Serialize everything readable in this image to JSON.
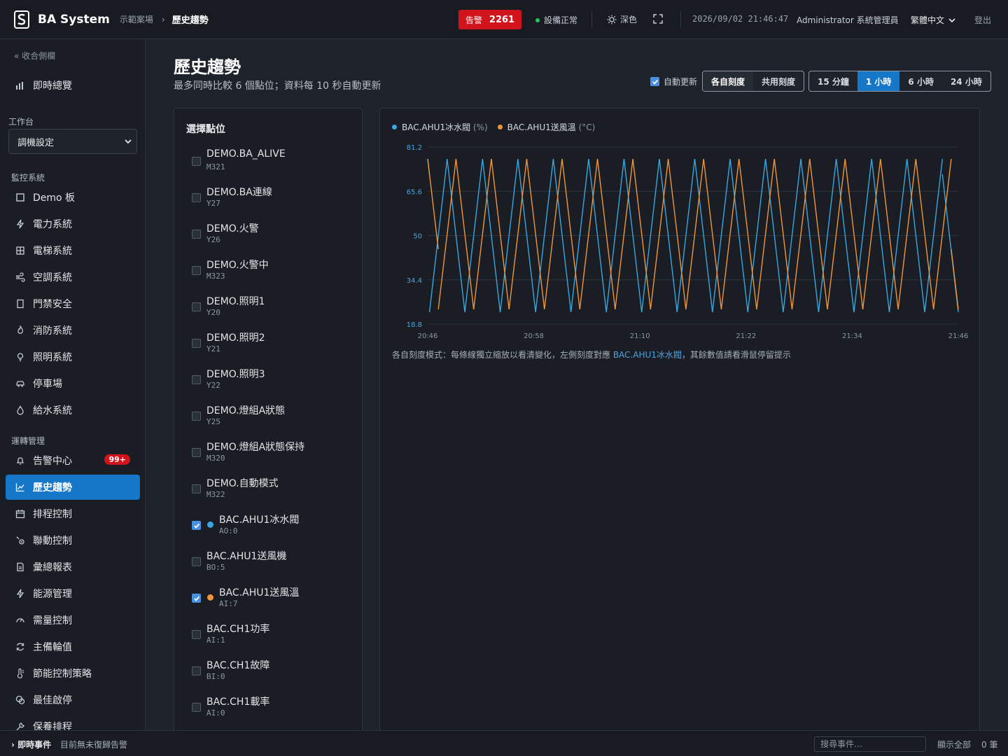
{
  "header": {
    "brand": "BA System",
    "site": "示範案場",
    "separator": "›",
    "current_page": "歷史趨勢",
    "alarm_label": "告警",
    "alarm_count": "2261",
    "device_status": "設備正常",
    "theme_label": "深色",
    "datetime": "2026/09/02 21:46:47",
    "user": "Administrator 系統管理員",
    "language": "繁體中文",
    "logout": "登出",
    "status_color": "#22c55e",
    "alarm_color": "#d1141c"
  },
  "sidebar": {
    "collapse_label": "« 收合側欄",
    "overview": "即時總覽",
    "workbench_label": "工作台",
    "workbench_value": "調機設定",
    "monitor_label": "監控系統",
    "monitor_items": [
      {
        "label": "Demo 板",
        "icon": "square-icon"
      },
      {
        "label": "電力系統",
        "icon": "bolt-icon"
      },
      {
        "label": "電梯系統",
        "icon": "elevator-icon"
      },
      {
        "label": "空調系統",
        "icon": "wind-icon"
      },
      {
        "label": "門禁安全",
        "icon": "door-icon"
      },
      {
        "label": "消防系統",
        "icon": "flame-icon"
      },
      {
        "label": "照明系統",
        "icon": "bulb-icon"
      },
      {
        "label": "停車場",
        "icon": "car-icon"
      },
      {
        "label": "給水系統",
        "icon": "drop-icon"
      }
    ],
    "ops_label": "運轉管理",
    "ops_items": [
      {
        "label": "告警中心",
        "icon": "bell-icon",
        "badge": "99+"
      },
      {
        "label": "歷史趨勢",
        "icon": "trend-icon",
        "active": true
      },
      {
        "label": "排程控制",
        "icon": "calendar-icon"
      },
      {
        "label": "聯動控制",
        "icon": "link-icon"
      },
      {
        "label": "彙總報表",
        "icon": "report-icon"
      },
      {
        "label": "能源管理",
        "icon": "bolt-icon"
      },
      {
        "label": "需量控制",
        "icon": "gauge-icon"
      },
      {
        "label": "主備輪值",
        "icon": "rotate-icon"
      },
      {
        "label": "節能控制策略",
        "icon": "thermometer-icon"
      },
      {
        "label": "最佳啟停",
        "icon": "optimize-icon"
      },
      {
        "label": "保養排程",
        "icon": "wrench-icon"
      }
    ]
  },
  "page": {
    "title": "歷史趨勢",
    "subtitle": "最多同時比較 6 個點位；資料每 10 秒自動更新",
    "auto_refresh": "自動更新",
    "scale_modes": [
      "各自刻度",
      "共用刻度"
    ],
    "ranges": [
      "15 分鐘",
      "1 小時",
      "6 小時",
      "24 小時"
    ]
  },
  "points": {
    "title": "選擇點位",
    "items": [
      {
        "name": "DEMO.BA_ALIVE",
        "code": "M321",
        "checked": false
      },
      {
        "name": "DEMO.BA連線",
        "code": "Y27",
        "checked": false
      },
      {
        "name": "DEMO.火警",
        "code": "Y26",
        "checked": false
      },
      {
        "name": "DEMO.火警中",
        "code": "M323",
        "checked": false
      },
      {
        "name": "DEMO.照明1",
        "code": "Y20",
        "checked": false
      },
      {
        "name": "DEMO.照明2",
        "code": "Y21",
        "checked": false
      },
      {
        "name": "DEMO.照明3",
        "code": "Y22",
        "checked": false
      },
      {
        "name": "DEMO.燈組A狀態",
        "code": "Y25",
        "checked": false
      },
      {
        "name": "DEMO.燈組A狀態保持",
        "code": "M320",
        "checked": false
      },
      {
        "name": "DEMO.自動模式",
        "code": "M322",
        "checked": false
      },
      {
        "name": "BAC.AHU1冰水閥",
        "code": "AO:0",
        "checked": true,
        "color": "#3aa6e0"
      },
      {
        "name": "BAC.AHU1送風機",
        "code": "BO:5",
        "checked": false
      },
      {
        "name": "BAC.AHU1送風溫",
        "code": "AI:7",
        "checked": true,
        "color": "#f0953a"
      },
      {
        "name": "BAC.CH1功率",
        "code": "AI:1",
        "checked": false
      },
      {
        "name": "BAC.CH1故障",
        "code": "BI:0",
        "checked": false
      },
      {
        "name": "BAC.CH1載率",
        "code": "AI:0",
        "checked": false
      }
    ]
  },
  "chart_data": {
    "type": "line",
    "title": "",
    "xlabel": "",
    "ylabel": "",
    "y_ticks": [
      81.2,
      65.6,
      50,
      34.4,
      18.8
    ],
    "ylim": [
      18.8,
      81.2
    ],
    "x_ticks": [
      "20:46",
      "20:58",
      "21:10",
      "21:22",
      "21:34",
      "21:46"
    ],
    "grid": true,
    "legend_position": "top-left",
    "series": [
      {
        "name": "BAC.AHU1冰水閥",
        "unit": "(%)",
        "color": "#3aa6e0",
        "pattern": "sawtooth",
        "min": 23,
        "max": 77,
        "period_min": 2,
        "phase": 0.1
      },
      {
        "name": "BAC.AHU1送風溫",
        "unit": "(°C)",
        "color": "#f0953a",
        "pattern": "sawtooth",
        "min": 24,
        "max": 77,
        "period_min": 2,
        "phase": 0.6
      }
    ],
    "note_prefix": "各自刻度模式：每條線獨立縮放以看清變化，左側刻度對應 ",
    "note_point": "BAC.AHU1冰水閥",
    "note_suffix": "，其餘數值請看滑鼠停留提示"
  },
  "bottom": {
    "realtime_label": "› 即時事件",
    "message": "目前無未復歸告警",
    "search_placeholder": "搜尋事件…",
    "show_all": "顯示全部",
    "count": "0 筆"
  }
}
